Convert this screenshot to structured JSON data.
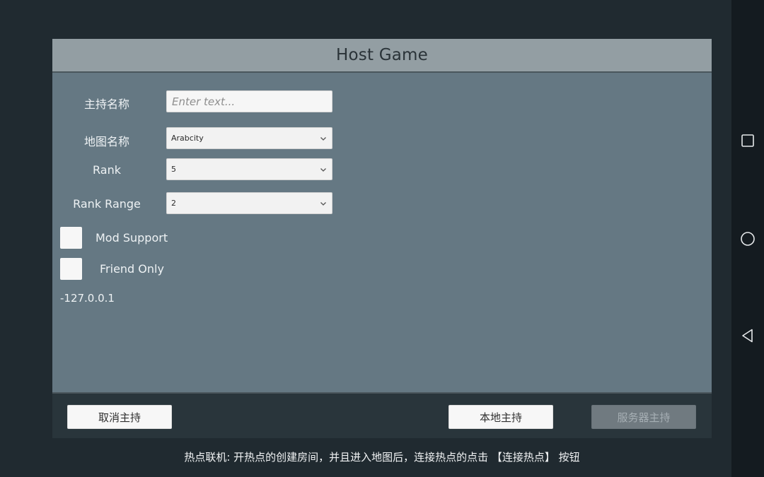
{
  "dialog": {
    "title": "Host Game"
  },
  "form": {
    "host_name": {
      "label": "主持名称",
      "placeholder": "Enter text...",
      "value": ""
    },
    "map_name": {
      "label": "地图名称",
      "value": "Arabcity"
    },
    "rank": {
      "label": "Rank",
      "value": "5"
    },
    "rank_range": {
      "label": "Rank Range",
      "value": "2"
    },
    "mod_support": {
      "label": "Mod Support",
      "checked": false
    },
    "friend_only": {
      "label": "Friend Only",
      "checked": false
    },
    "ip_address": "-127.0.0.1"
  },
  "footer": {
    "cancel_label": "取消主持",
    "local_host_label": "本地主持",
    "server_host_label": "服务器主持"
  },
  "hint_text": "热点联机: 开热点的创建房间，并且进入地图后，连接热点的点击 【连接热点】 按钮",
  "navbar": {
    "icons": [
      "recent-apps-icon",
      "home-icon",
      "back-icon"
    ]
  },
  "colors": {
    "background": "#202a30",
    "dialog_body": "#657883",
    "dialog_header": "#939ea3",
    "footer": "#29353b",
    "disabled_button": "#707a80"
  }
}
